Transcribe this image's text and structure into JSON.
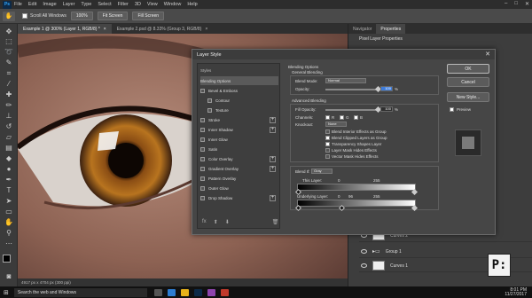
{
  "app": {
    "logo": "Ps",
    "menu": [
      "File",
      "Edit",
      "Image",
      "Layer",
      "Type",
      "Select",
      "Filter",
      "3D",
      "View",
      "Window",
      "Help"
    ]
  },
  "options_bar": {
    "scroll_all_windows": "Scroll All Windows",
    "zoom": "100%",
    "fit_screen": "Fit Screen",
    "fill_screen": "Fill Screen"
  },
  "doc_tabs": [
    {
      "label": "Example 1 @ 300% (Layer 1, RGB/8) *",
      "active": true
    },
    {
      "label": "Example 2.psd @ 8.33% (Group 3, RGB/8)",
      "active": false
    }
  ],
  "status": "4917 px x 4704 px (300 ppi)",
  "right_panel": {
    "tabs": [
      "Navigator",
      "Properties"
    ],
    "subtitle": "Pixel Layer Properties",
    "layers": [
      {
        "name": "Curves 2"
      },
      {
        "name": "Group 1"
      },
      {
        "name": "Curves 1"
      }
    ]
  },
  "dialog": {
    "title": "Layer Style",
    "styles_header": "Styles",
    "styles": [
      {
        "label": "Blending Options",
        "checkbox": false,
        "plus": false,
        "selected": true
      },
      {
        "label": "Bevel & Emboss",
        "checkbox": true,
        "plus": false
      },
      {
        "label": "Contour",
        "checkbox": true,
        "plus": false,
        "indent": true
      },
      {
        "label": "Texture",
        "checkbox": true,
        "plus": false,
        "indent": true
      },
      {
        "label": "Stroke",
        "checkbox": true,
        "plus": true
      },
      {
        "label": "Inner Shadow",
        "checkbox": true,
        "plus": true
      },
      {
        "label": "Inner Glow",
        "checkbox": true,
        "plus": false
      },
      {
        "label": "Satin",
        "checkbox": true,
        "plus": false
      },
      {
        "label": "Color Overlay",
        "checkbox": true,
        "plus": true
      },
      {
        "label": "Gradient Overlay",
        "checkbox": true,
        "plus": true
      },
      {
        "label": "Pattern Overlay",
        "checkbox": true,
        "plus": false
      },
      {
        "label": "Outer Glow",
        "checkbox": true,
        "plus": false
      },
      {
        "label": "Drop Shadow",
        "checkbox": true,
        "plus": true
      }
    ],
    "fx": "fx",
    "blending": {
      "section": "Blending Options",
      "general": "General Blending",
      "blend_mode_label": "Blend Mode:",
      "blend_mode": "Normal",
      "opacity_label": "Opacity:",
      "opacity": "100",
      "opacity_unit": "%",
      "advanced": "Advanced Blending",
      "fill_opacity_label": "Fill Opacity:",
      "fill_opacity": "100",
      "channels_label": "Channels:",
      "channels": [
        "R",
        "G",
        "B"
      ],
      "knockout_label": "Knockout:",
      "knockout": "None",
      "options": [
        {
          "label": "Blend Interior Effects as Group",
          "checked": false
        },
        {
          "label": "Blend Clipped Layers as Group",
          "checked": true
        },
        {
          "label": "Transparency Shapes Layer",
          "checked": true
        },
        {
          "label": "Layer Mask Hides Effects",
          "checked": false
        },
        {
          "label": "Vector Mask Hides Effects",
          "checked": false
        }
      ],
      "blend_if_label": "Blend If:",
      "blend_if": "Gray",
      "this_layer_label": "This Layer:",
      "this_layer_min": "0",
      "this_layer_max": "255",
      "underlying_label": "Underlying Layer:",
      "underlying_min": "0",
      "underlying_mid": "96",
      "underlying_max": "255"
    },
    "buttons": {
      "ok": "OK",
      "cancel": "Cancel",
      "new_style": "New Style...",
      "preview": "Preview"
    }
  },
  "taskbar": {
    "search": "Search the web and Windows",
    "time": "8:01 PM",
    "date": "11/27/2017"
  },
  "watermark": "P:"
}
